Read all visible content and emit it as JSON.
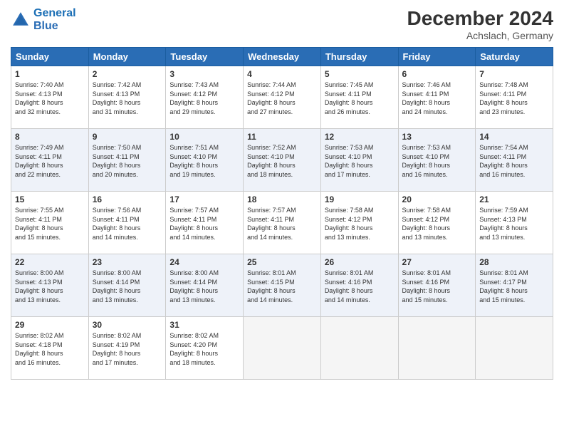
{
  "header": {
    "logo_line1": "General",
    "logo_line2": "Blue",
    "month": "December 2024",
    "location": "Achslach, Germany"
  },
  "weekdays": [
    "Sunday",
    "Monday",
    "Tuesday",
    "Wednesday",
    "Thursday",
    "Friday",
    "Saturday"
  ],
  "weeks": [
    [
      {
        "day": "1",
        "lines": [
          "Sunrise: 7:40 AM",
          "Sunset: 4:13 PM",
          "Daylight: 8 hours",
          "and 32 minutes."
        ]
      },
      {
        "day": "2",
        "lines": [
          "Sunrise: 7:42 AM",
          "Sunset: 4:13 PM",
          "Daylight: 8 hours",
          "and 31 minutes."
        ]
      },
      {
        "day": "3",
        "lines": [
          "Sunrise: 7:43 AM",
          "Sunset: 4:12 PM",
          "Daylight: 8 hours",
          "and 29 minutes."
        ]
      },
      {
        "day": "4",
        "lines": [
          "Sunrise: 7:44 AM",
          "Sunset: 4:12 PM",
          "Daylight: 8 hours",
          "and 27 minutes."
        ]
      },
      {
        "day": "5",
        "lines": [
          "Sunrise: 7:45 AM",
          "Sunset: 4:11 PM",
          "Daylight: 8 hours",
          "and 26 minutes."
        ]
      },
      {
        "day": "6",
        "lines": [
          "Sunrise: 7:46 AM",
          "Sunset: 4:11 PM",
          "Daylight: 8 hours",
          "and 24 minutes."
        ]
      },
      {
        "day": "7",
        "lines": [
          "Sunrise: 7:48 AM",
          "Sunset: 4:11 PM",
          "Daylight: 8 hours",
          "and 23 minutes."
        ]
      }
    ],
    [
      {
        "day": "8",
        "lines": [
          "Sunrise: 7:49 AM",
          "Sunset: 4:11 PM",
          "Daylight: 8 hours",
          "and 22 minutes."
        ]
      },
      {
        "day": "9",
        "lines": [
          "Sunrise: 7:50 AM",
          "Sunset: 4:11 PM",
          "Daylight: 8 hours",
          "and 20 minutes."
        ]
      },
      {
        "day": "10",
        "lines": [
          "Sunrise: 7:51 AM",
          "Sunset: 4:10 PM",
          "Daylight: 8 hours",
          "and 19 minutes."
        ]
      },
      {
        "day": "11",
        "lines": [
          "Sunrise: 7:52 AM",
          "Sunset: 4:10 PM",
          "Daylight: 8 hours",
          "and 18 minutes."
        ]
      },
      {
        "day": "12",
        "lines": [
          "Sunrise: 7:53 AM",
          "Sunset: 4:10 PM",
          "Daylight: 8 hours",
          "and 17 minutes."
        ]
      },
      {
        "day": "13",
        "lines": [
          "Sunrise: 7:53 AM",
          "Sunset: 4:10 PM",
          "Daylight: 8 hours",
          "and 16 minutes."
        ]
      },
      {
        "day": "14",
        "lines": [
          "Sunrise: 7:54 AM",
          "Sunset: 4:11 PM",
          "Daylight: 8 hours",
          "and 16 minutes."
        ]
      }
    ],
    [
      {
        "day": "15",
        "lines": [
          "Sunrise: 7:55 AM",
          "Sunset: 4:11 PM",
          "Daylight: 8 hours",
          "and 15 minutes."
        ]
      },
      {
        "day": "16",
        "lines": [
          "Sunrise: 7:56 AM",
          "Sunset: 4:11 PM",
          "Daylight: 8 hours",
          "and 14 minutes."
        ]
      },
      {
        "day": "17",
        "lines": [
          "Sunrise: 7:57 AM",
          "Sunset: 4:11 PM",
          "Daylight: 8 hours",
          "and 14 minutes."
        ]
      },
      {
        "day": "18",
        "lines": [
          "Sunrise: 7:57 AM",
          "Sunset: 4:11 PM",
          "Daylight: 8 hours",
          "and 14 minutes."
        ]
      },
      {
        "day": "19",
        "lines": [
          "Sunrise: 7:58 AM",
          "Sunset: 4:12 PM",
          "Daylight: 8 hours",
          "and 13 minutes."
        ]
      },
      {
        "day": "20",
        "lines": [
          "Sunrise: 7:58 AM",
          "Sunset: 4:12 PM",
          "Daylight: 8 hours",
          "and 13 minutes."
        ]
      },
      {
        "day": "21",
        "lines": [
          "Sunrise: 7:59 AM",
          "Sunset: 4:13 PM",
          "Daylight: 8 hours",
          "and 13 minutes."
        ]
      }
    ],
    [
      {
        "day": "22",
        "lines": [
          "Sunrise: 8:00 AM",
          "Sunset: 4:13 PM",
          "Daylight: 8 hours",
          "and 13 minutes."
        ]
      },
      {
        "day": "23",
        "lines": [
          "Sunrise: 8:00 AM",
          "Sunset: 4:14 PM",
          "Daylight: 8 hours",
          "and 13 minutes."
        ]
      },
      {
        "day": "24",
        "lines": [
          "Sunrise: 8:00 AM",
          "Sunset: 4:14 PM",
          "Daylight: 8 hours",
          "and 13 minutes."
        ]
      },
      {
        "day": "25",
        "lines": [
          "Sunrise: 8:01 AM",
          "Sunset: 4:15 PM",
          "Daylight: 8 hours",
          "and 14 minutes."
        ]
      },
      {
        "day": "26",
        "lines": [
          "Sunrise: 8:01 AM",
          "Sunset: 4:16 PM",
          "Daylight: 8 hours",
          "and 14 minutes."
        ]
      },
      {
        "day": "27",
        "lines": [
          "Sunrise: 8:01 AM",
          "Sunset: 4:16 PM",
          "Daylight: 8 hours",
          "and 15 minutes."
        ]
      },
      {
        "day": "28",
        "lines": [
          "Sunrise: 8:01 AM",
          "Sunset: 4:17 PM",
          "Daylight: 8 hours",
          "and 15 minutes."
        ]
      }
    ],
    [
      {
        "day": "29",
        "lines": [
          "Sunrise: 8:02 AM",
          "Sunset: 4:18 PM",
          "Daylight: 8 hours",
          "and 16 minutes."
        ]
      },
      {
        "day": "30",
        "lines": [
          "Sunrise: 8:02 AM",
          "Sunset: 4:19 PM",
          "Daylight: 8 hours",
          "and 17 minutes."
        ]
      },
      {
        "day": "31",
        "lines": [
          "Sunrise: 8:02 AM",
          "Sunset: 4:20 PM",
          "Daylight: 8 hours",
          "and 18 minutes."
        ]
      },
      null,
      null,
      null,
      null
    ]
  ]
}
